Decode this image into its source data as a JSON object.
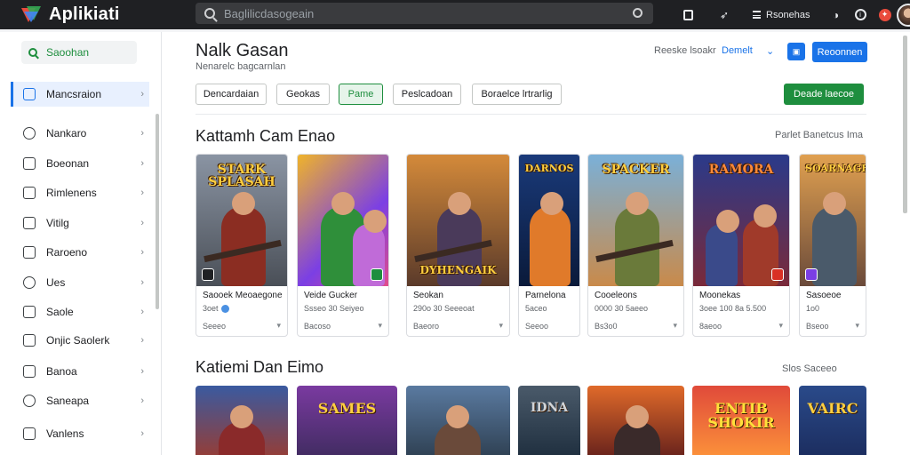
{
  "app": {
    "name": "Aplikiati"
  },
  "search": {
    "placeholder": "Baglilicdasogeain"
  },
  "topbar": {
    "label": "Rsonehas"
  },
  "sidebar": {
    "search_label": "Saoohan",
    "items": [
      {
        "label": "Mancsraion",
        "active": true
      },
      {
        "label": "Nankaro"
      },
      {
        "label": "Boeonan"
      },
      {
        "label": "Rimlenens"
      },
      {
        "label": "Vitilg"
      },
      {
        "label": "Raroeno"
      },
      {
        "label": "Ues"
      },
      {
        "label": "Saole"
      },
      {
        "label": "Onjic Saolerk"
      },
      {
        "label": "Banoa"
      },
      {
        "label": "Saneapa"
      },
      {
        "label": "Vanlens"
      }
    ]
  },
  "header": {
    "title": "Nalk Gasan",
    "subtitle": "Nenarelc bagcarnlan",
    "link1": "Reeske lsoakr",
    "link2": "Demelt",
    "primary_button": "Reoonnen"
  },
  "chips": [
    "Dencardaian",
    "Geokas",
    "Pame",
    "Peslcadoan",
    "Boraelce lrtrarlig"
  ],
  "active_chip": 2,
  "cta_label": "Deade laecoe",
  "section1": {
    "title": "Kattamh Cam Enao",
    "link": "Parlet Banetcus Ima",
    "cards": [
      {
        "art": "STARK SPLASAH",
        "name": "Saooek Meoaegone",
        "meta": "3oet",
        "foot": "Seeeo"
      },
      {
        "art": "",
        "name": "Veide Gucker",
        "meta": "Ssseo 30 Seiyeo",
        "foot": "Bacoso"
      },
      {
        "art": "DYHENGAIK",
        "name": "Seokan",
        "meta": "290o 30 Seeeoat",
        "foot": "Baeoro"
      },
      {
        "art": "DARNOS",
        "name": "Parnelona",
        "meta": "5aceo",
        "foot": "Seeoo"
      },
      {
        "art": "SPACKER",
        "name": "Cooeleons",
        "meta": "0000 30 5aeeo",
        "foot": "Bs3o0"
      },
      {
        "art": "RAMORA",
        "name": "Moonekas",
        "meta": "3oee 100 8a 5.500",
        "foot": "8aeoo"
      },
      {
        "art": "SOARNAGE",
        "name": "Sasoeoe",
        "meta": "1o0",
        "foot": "Bseoo"
      }
    ]
  },
  "section2": {
    "title": "Katiemi Dan Eimo",
    "link": "Slos Saceeo",
    "cards": [
      {
        "art": ""
      },
      {
        "art": "SAMES"
      },
      {
        "art": ""
      },
      {
        "art": "IDNA"
      },
      {
        "art": ""
      },
      {
        "art": "ENTIB SHOKIR"
      },
      {
        "art": "VAIRC"
      }
    ]
  }
}
